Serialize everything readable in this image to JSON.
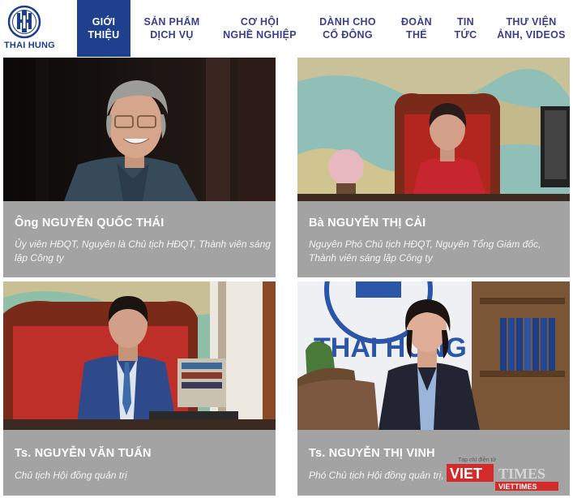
{
  "nav": {
    "logo_text": "THAI HUNG",
    "items": [
      {
        "label": "GIỚI\nTHIỆU",
        "active": true
      },
      {
        "label": "SẢN PHẨM\nDỊCH VỤ",
        "active": false
      },
      {
        "label": "CƠ HỘI\nNGHỀ NGHIỆP",
        "active": false
      },
      {
        "label": "DÀNH CHO\nCỔ ĐÔNG",
        "active": false
      },
      {
        "label": "ĐOÀN\nTHỂ",
        "active": false
      },
      {
        "label": "TIN\nTỨC",
        "active": false
      },
      {
        "label": "THƯ VIỆN\nẢNH, VIDEOS",
        "active": false
      }
    ]
  },
  "people": [
    {
      "name": "Ông NGUYỄN QUỐC THÁI",
      "desc": "Ủy viên HĐQT, Nguyên là Chủ tịch HĐQT, Thành viên sáng\nlập Công ty"
    },
    {
      "name": "Bà NGUYỄN THỊ CẢI",
      "desc": "Nguyên Phó Chủ tịch HĐQT, Nguyên Tổng Giám đốc,\nThành viên sáng lập Công ty"
    },
    {
      "name": "Ts. NGUYỄN VĂN TUẤN",
      "desc": "Chủ tịch Hội đồng quản trị"
    },
    {
      "name": "Ts. NGUYỄN THỊ VINH",
      "desc": "Phó Chủ tịch Hội đồng quản trị, T"
    }
  ],
  "photo_texts": {
    "sign_text": "THAI HUNG"
  },
  "watermark": {
    "tagline": "Tạp chí điện tử",
    "brand_left": "VIET",
    "brand_right": "TIMES",
    "brand_small": "VIETTIMES"
  },
  "colors": {
    "nav_active_bg": "#1f3f8f",
    "nav_text": "#3a3f8c",
    "card_bg": "#a3a3a3",
    "watermark_red": "#d42a2a"
  }
}
